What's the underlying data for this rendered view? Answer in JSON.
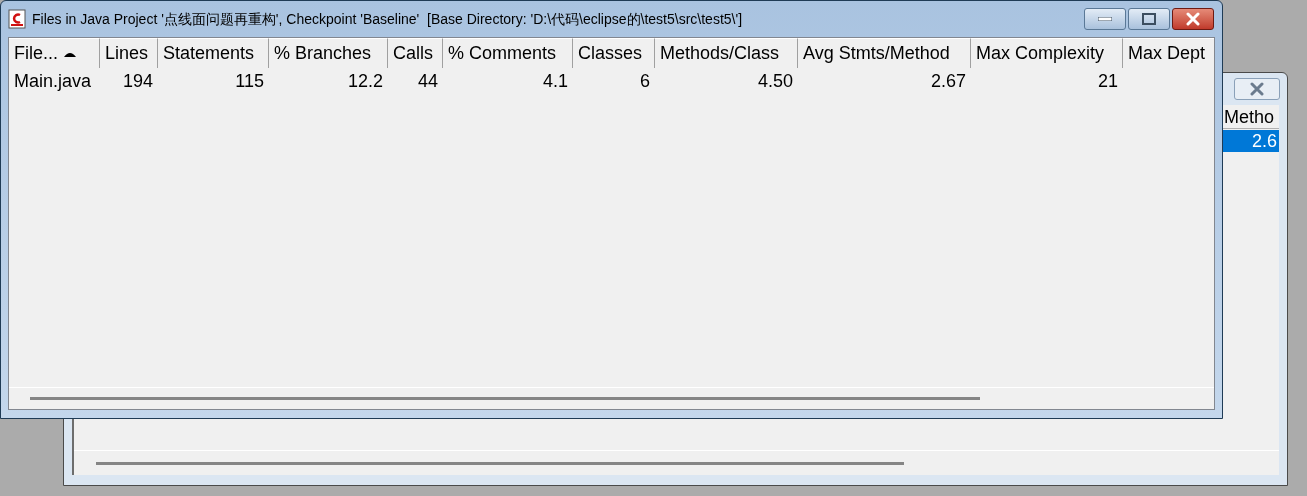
{
  "front_window": {
    "title": "Files in Java Project '点线面问题再重构', Checkpoint 'Baseline'  [Base Directory: 'D:\\代码\\eclipse的\\test5\\src\\test5\\']",
    "columns": [
      {
        "label": "File...",
        "sorted": true
      },
      {
        "label": "Lines",
        "sorted": false
      },
      {
        "label": "Statements",
        "sorted": false
      },
      {
        "label": "% Branches",
        "sorted": false
      },
      {
        "label": "Calls",
        "sorted": false
      },
      {
        "label": "% Comments",
        "sorted": false
      },
      {
        "label": "Classes",
        "sorted": false
      },
      {
        "label": "Methods/Class",
        "sorted": false
      },
      {
        "label": "Avg Stmts/Method",
        "sorted": false
      },
      {
        "label": "Max Complexity",
        "sorted": false
      },
      {
        "label": "Max Dept",
        "sorted": false
      }
    ],
    "rows": [
      {
        "cells": [
          "Main.java",
          "194",
          "115",
          "12.2",
          "44",
          "4.1",
          "6",
          "4.50",
          "2.67",
          "21"
        ]
      }
    ]
  },
  "back_window": {
    "columns": [
      {
        "label": "Metho"
      }
    ],
    "rows": [
      {
        "cells": [
          "2.6"
        ],
        "selected": true
      }
    ]
  }
}
